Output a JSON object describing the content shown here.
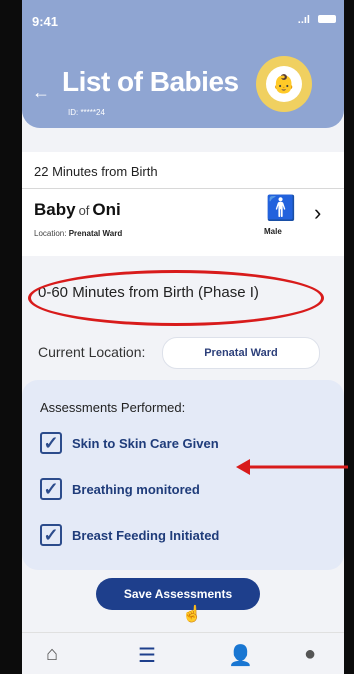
{
  "status_bar": {
    "time": "9:41",
    "signal": "..ıl"
  },
  "header": {
    "back_icon": "back-arrow-icon",
    "title": "List of Babies",
    "id_label": "ID: *****24",
    "logo_icon": "org-logo"
  },
  "baby_card": {
    "minutes_from_birth": "22 Minutes from Birth",
    "name_first": "Baby",
    "name_of": "of",
    "name_last": "Oni",
    "location_label": "Location:",
    "location_value": "Prenatal Ward",
    "gender_label": "Male"
  },
  "phase_label": "0-60 Minutes from Birth (Phase I)",
  "current_location": {
    "label": "Current Location:",
    "value": "Prenatal Ward"
  },
  "assessments": {
    "title": "Assessments Performed:",
    "items": [
      {
        "label": "Skin to Skin Care Given",
        "checked": true
      },
      {
        "label": "Breathing monitored",
        "checked": true
      },
      {
        "label": "Breast Feeding Initiated",
        "checked": true
      }
    ]
  },
  "save_button": "Save Assessments",
  "bottom_nav": {
    "items": [
      "home-icon",
      "list-icon",
      "nurse-icon",
      "profile-icon"
    ]
  },
  "colors": {
    "header": "#8fa5d2",
    "accent": "#1e3f8c",
    "annotation": "#d81b1b"
  }
}
